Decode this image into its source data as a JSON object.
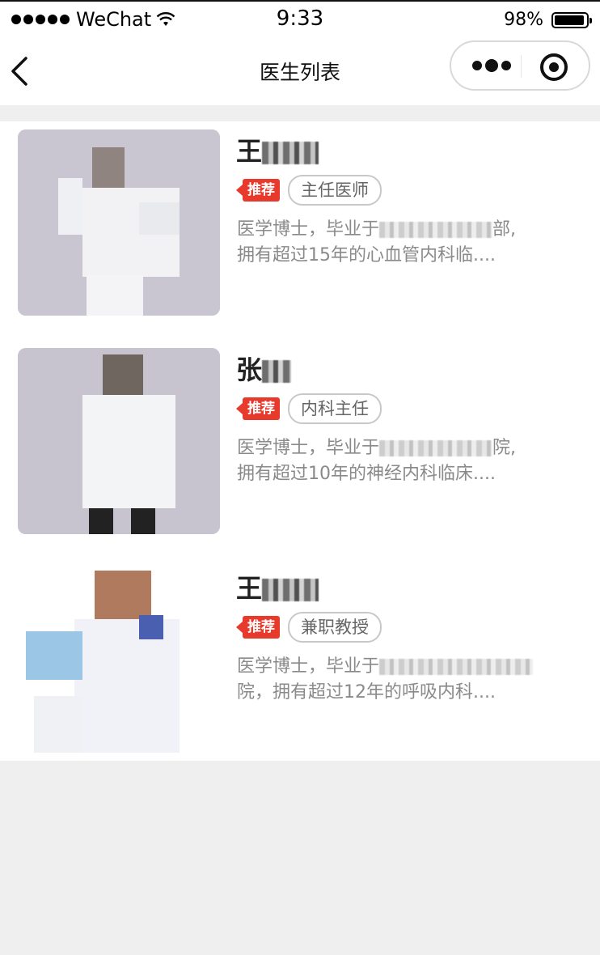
{
  "status_bar": {
    "carrier": "WeChat",
    "time": "9:33",
    "battery": "98%",
    "battery_level": 0.98
  },
  "nav": {
    "title": "医生列表"
  },
  "doctors": [
    {
      "name": "王",
      "recommend_label": "推荐",
      "title": "主任医师",
      "desc_line1_prefix": "医学博士，毕业于",
      "desc_line1_suffix": "部,",
      "desc_line2": "拥有超过15年的心血管内科临...."
    },
    {
      "name": "张",
      "recommend_label": "推荐",
      "title": "内科主任",
      "desc_line1_prefix": "医学博士，毕业于",
      "desc_line1_suffix": "院,",
      "desc_line2": "拥有超过10年的神经内科临床...."
    },
    {
      "name": "王",
      "recommend_label": "推荐",
      "title": "兼职教授",
      "desc_line1_prefix": "医学博士，毕业于",
      "desc_line1_suffix": "",
      "desc_line2": "院，拥有超过12年的呼吸内科...."
    }
  ]
}
